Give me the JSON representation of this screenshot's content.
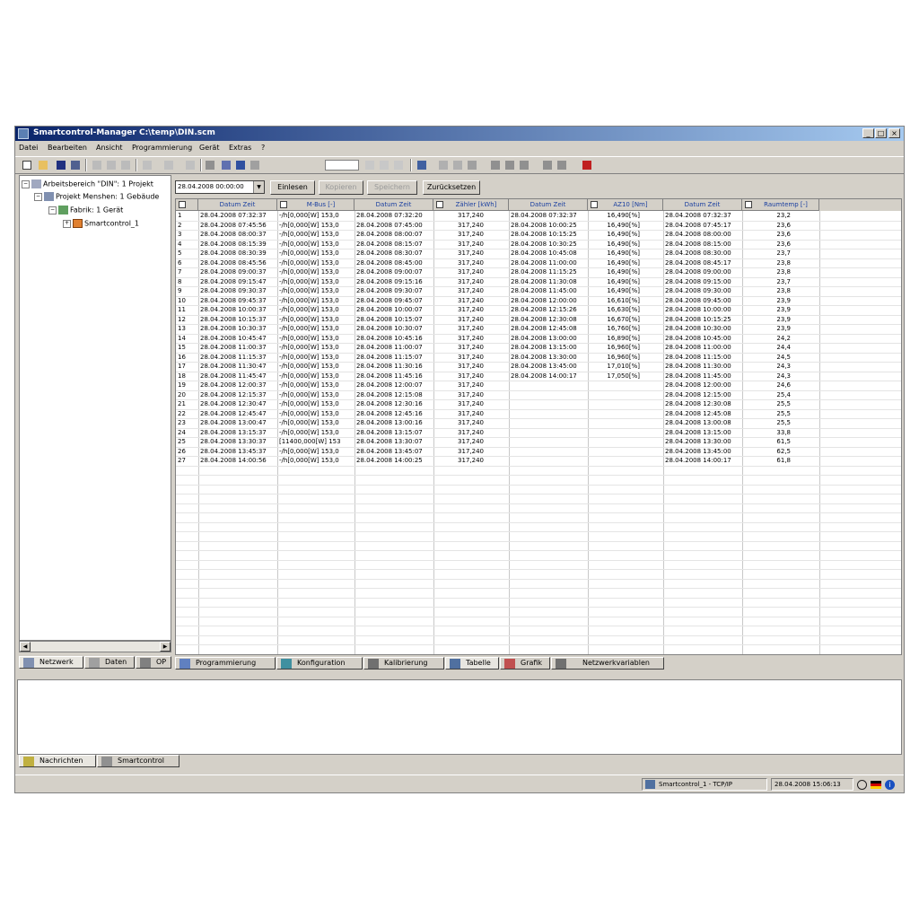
{
  "window": {
    "title": "Smartcontrol-Manager C:\\temp\\DIN.scm",
    "min": "_",
    "max": "□",
    "close": "×"
  },
  "menu": [
    "Datei",
    "Bearbeiten",
    "Ansicht",
    "Programmierung",
    "Gerät",
    "Extras",
    "?"
  ],
  "tree": {
    "workspace": "Arbeitsbereich \"DIN\": 1 Projekt",
    "project": "Projekt Menshen: 1 Gebäude",
    "factory": "Fabrik: 1 Gerät",
    "device": "Smartcontrol_1"
  },
  "left_tabs": [
    "Netzwerk",
    "Daten",
    "OP"
  ],
  "filter": {
    "date": "28.04.2008 00:00:00",
    "read": "Einlesen",
    "copy": "Kopieren",
    "save": "Speichern",
    "reset": "Zurücksetzen"
  },
  "table": {
    "headers": [
      "Datum Zeit",
      "M-Bus [-]",
      "Datum Zeit",
      "Zähler [kWh]",
      "Datum Zeit",
      "AZ10 [Nm]",
      "Datum Zeit",
      "Raumtemp [-]"
    ],
    "rows": [
      {
        "n": "1",
        "d1": "28.04.2008 07:32:37",
        "m": "-/h[0,000[W] 153,0",
        "d2": "28.04.2008 07:32:20",
        "z": "317,240",
        "d3": "28.04.2008 07:32:37",
        "a": "16,490[%]",
        "d4": "28.04.2008 07:32:37",
        "r": "23,2"
      },
      {
        "n": "2",
        "d1": "28.04.2008 07:45:56",
        "m": "-/h[0,000[W] 153,0",
        "d2": "28.04.2008 07:45:00",
        "z": "317,240",
        "d3": "28.04.2008 10:00:25",
        "a": "16,490[%]",
        "d4": "28.04.2008 07:45:17",
        "r": "23,6"
      },
      {
        "n": "3",
        "d1": "28.04.2008 08:00:37",
        "m": "-/h[0,000[W] 153,0",
        "d2": "28.04.2008 08:00:07",
        "z": "317,240",
        "d3": "28.04.2008 10:15:25",
        "a": "16,490[%]",
        "d4": "28.04.2008 08:00:00",
        "r": "23,6"
      },
      {
        "n": "4",
        "d1": "28.04.2008 08:15:39",
        "m": "-/h[0,000[W] 153,0",
        "d2": "28.04.2008 08:15:07",
        "z": "317,240",
        "d3": "28.04.2008 10:30:25",
        "a": "16,490[%]",
        "d4": "28.04.2008 08:15:00",
        "r": "23,6"
      },
      {
        "n": "5",
        "d1": "28.04.2008 08:30:39",
        "m": "-/h[0,000[W] 153,0",
        "d2": "28.04.2008 08:30:07",
        "z": "317,240",
        "d3": "28.04.2008 10:45:08",
        "a": "16,490[%]",
        "d4": "28.04.2008 08:30:00",
        "r": "23,7"
      },
      {
        "n": "6",
        "d1": "28.04.2008 08:45:56",
        "m": "-/h[0,000[W] 153,0",
        "d2": "28.04.2008 08:45:00",
        "z": "317,240",
        "d3": "28.04.2008 11:00:00",
        "a": "16,490[%]",
        "d4": "28.04.2008 08:45:17",
        "r": "23,8"
      },
      {
        "n": "7",
        "d1": "28.04.2008 09:00:37",
        "m": "-/h[0,000[W] 153,0",
        "d2": "28.04.2008 09:00:07",
        "z": "317,240",
        "d3": "28.04.2008 11:15:25",
        "a": "16,490[%]",
        "d4": "28.04.2008 09:00:00",
        "r": "23,8"
      },
      {
        "n": "8",
        "d1": "28.04.2008 09:15:47",
        "m": "-/h[0,000[W] 153,0",
        "d2": "28.04.2008 09:15:16",
        "z": "317,240",
        "d3": "28.04.2008 11:30:08",
        "a": "16,490[%]",
        "d4": "28.04.2008 09:15:00",
        "r": "23,7"
      },
      {
        "n": "9",
        "d1": "28.04.2008 09:30:37",
        "m": "-/h[0,000[W] 153,0",
        "d2": "28.04.2008 09:30:07",
        "z": "317,240",
        "d3": "28.04.2008 11:45:00",
        "a": "16,490[%]",
        "d4": "28.04.2008 09:30:00",
        "r": "23,8"
      },
      {
        "n": "10",
        "d1": "28.04.2008 09:45:37",
        "m": "-/h[0,000[W] 153,0",
        "d2": "28.04.2008 09:45:07",
        "z": "317,240",
        "d3": "28.04.2008 12:00:00",
        "a": "16,610[%]",
        "d4": "28.04.2008 09:45:00",
        "r": "23,9"
      },
      {
        "n": "11",
        "d1": "28.04.2008 10:00:37",
        "m": "-/h[0,000[W] 153,0",
        "d2": "28.04.2008 10:00:07",
        "z": "317,240",
        "d3": "28.04.2008 12:15:26",
        "a": "16,630[%]",
        "d4": "28.04.2008 10:00:00",
        "r": "23,9"
      },
      {
        "n": "12",
        "d1": "28.04.2008 10:15:37",
        "m": "-/h[0,000[W] 153,0",
        "d2": "28.04.2008 10:15:07",
        "z": "317,240",
        "d3": "28.04.2008 12:30:08",
        "a": "16,670[%]",
        "d4": "28.04.2008 10:15:25",
        "r": "23,9"
      },
      {
        "n": "13",
        "d1": "28.04.2008 10:30:37",
        "m": "-/h[0,000[W] 153,0",
        "d2": "28.04.2008 10:30:07",
        "z": "317,240",
        "d3": "28.04.2008 12:45:08",
        "a": "16,760[%]",
        "d4": "28.04.2008 10:30:00",
        "r": "23,9"
      },
      {
        "n": "14",
        "d1": "28.04.2008 10:45:47",
        "m": "-/h[0,000[W] 153,0",
        "d2": "28.04.2008 10:45:16",
        "z": "317,240",
        "d3": "28.04.2008 13:00:00",
        "a": "16,890[%]",
        "d4": "28.04.2008 10:45:00",
        "r": "24,2"
      },
      {
        "n": "15",
        "d1": "28.04.2008 11:00:37",
        "m": "-/h[0,000[W] 153,0",
        "d2": "28.04.2008 11:00:07",
        "z": "317,240",
        "d3": "28.04.2008 13:15:00",
        "a": "16,960[%]",
        "d4": "28.04.2008 11:00:00",
        "r": "24,4"
      },
      {
        "n": "16",
        "d1": "28.04.2008 11:15:37",
        "m": "-/h[0,000[W] 153,0",
        "d2": "28.04.2008 11:15:07",
        "z": "317,240",
        "d3": "28.04.2008 13:30:00",
        "a": "16,960[%]",
        "d4": "28.04.2008 11:15:00",
        "r": "24,5"
      },
      {
        "n": "17",
        "d1": "28.04.2008 11:30:47",
        "m": "-/h[0,000[W] 153,0",
        "d2": "28.04.2008 11:30:16",
        "z": "317,240",
        "d3": "28.04.2008 13:45:00",
        "a": "17,010[%]",
        "d4": "28.04.2008 11:30:00",
        "r": "24,3"
      },
      {
        "n": "18",
        "d1": "28.04.2008 11:45:47",
        "m": "-/h[0,000[W] 153,0",
        "d2": "28.04.2008 11:45:16",
        "z": "317,240",
        "d3": "28.04.2008 14:00:17",
        "a": "17,050[%]",
        "d4": "28.04.2008 11:45:00",
        "r": "24,3"
      },
      {
        "n": "19",
        "d1": "28.04.2008 12:00:37",
        "m": "-/h[0,000[W] 153,0",
        "d2": "28.04.2008 12:00:07",
        "z": "317,240",
        "d3": "",
        "a": "",
        "d4": "28.04.2008 12:00:00",
        "r": "24,6"
      },
      {
        "n": "20",
        "d1": "28.04.2008 12:15:37",
        "m": "-/h[0,000[W] 153,0",
        "d2": "28.04.2008 12:15:08",
        "z": "317,240",
        "d3": "",
        "a": "",
        "d4": "28.04.2008 12:15:00",
        "r": "25,4"
      },
      {
        "n": "21",
        "d1": "28.04.2008 12:30:47",
        "m": "-/h[0,000[W] 153,0",
        "d2": "28.04.2008 12:30:16",
        "z": "317,240",
        "d3": "",
        "a": "",
        "d4": "28.04.2008 12:30:08",
        "r": "25,5"
      },
      {
        "n": "22",
        "d1": "28.04.2008 12:45:47",
        "m": "-/h[0,000[W] 153,0",
        "d2": "28.04.2008 12:45:16",
        "z": "317,240",
        "d3": "",
        "a": "",
        "d4": "28.04.2008 12:45:08",
        "r": "25,5"
      },
      {
        "n": "23",
        "d1": "28.04.2008 13:00:47",
        "m": "-/h[0,000[W] 153,0",
        "d2": "28.04.2008 13:00:16",
        "z": "317,240",
        "d3": "",
        "a": "",
        "d4": "28.04.2008 13:00:08",
        "r": "25,5"
      },
      {
        "n": "24",
        "d1": "28.04.2008 13:15:37",
        "m": "-/h[0,000[W] 153,0",
        "d2": "28.04.2008 13:15:07",
        "z": "317,240",
        "d3": "",
        "a": "",
        "d4": "28.04.2008 13:15:00",
        "r": "33,8"
      },
      {
        "n": "25",
        "d1": "28.04.2008 13:30:37",
        "m": "[11400,000[W] 153",
        "d2": "28.04.2008 13:30:07",
        "z": "317,240",
        "d3": "",
        "a": "",
        "d4": "28.04.2008 13:30:00",
        "r": "61,5"
      },
      {
        "n": "26",
        "d1": "28.04.2008 13:45:37",
        "m": "-/h[0,000[W] 153,0",
        "d2": "28.04.2008 13:45:07",
        "z": "317,240",
        "d3": "",
        "a": "",
        "d4": "28.04.2008 13:45:00",
        "r": "62,5"
      },
      {
        "n": "27",
        "d1": "28.04.2008 14:00:56",
        "m": "-/h[0,000[W] 153,0",
        "d2": "28.04.2008 14:00:25",
        "z": "317,240",
        "d3": "",
        "a": "",
        "d4": "28.04.2008 14:00:17",
        "r": "61,8"
      }
    ]
  },
  "right_tabs": [
    "Programmierung",
    "Konfiguration",
    "Kalibrierung",
    "Tabelle",
    "Grafik",
    "Netzwerkvariablen"
  ],
  "bottom_tabs": [
    "Nachrichten",
    "Smartcontrol"
  ],
  "status": {
    "connection": "Smartcontrol_1 - TCP/IP",
    "datetime": "28.04.2008 15:06:13"
  },
  "colors": {
    "title_start": "#0a246a",
    "title_end": "#a6caf0",
    "header_text": "#1a3fa0"
  }
}
